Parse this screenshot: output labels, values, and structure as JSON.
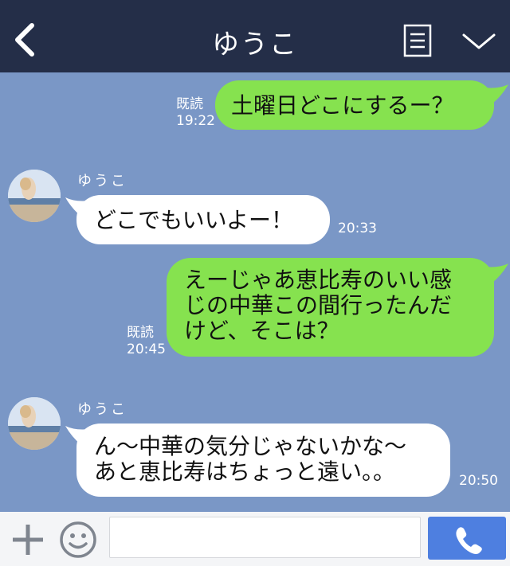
{
  "header": {
    "title": "ゆうこ"
  },
  "messages": [
    {
      "dir": "out",
      "text": "土曜日どこにするー？",
      "read": "既読",
      "time": "19:22"
    },
    {
      "dir": "in",
      "sender": "ゆうこ",
      "text": "どこでもいいよー！",
      "time": "20:33"
    },
    {
      "dir": "out",
      "lines": [
        "えーじゃあ恵比寿のいい感",
        "じの中華この間行ったんだ",
        "けど、そこは？"
      ],
      "read": "既読",
      "time": "20:45"
    },
    {
      "dir": "in",
      "sender": "ゆうこ",
      "lines": [
        "ん〜中華の気分じゃないかな〜",
        "あと恵比寿はちょっと遠い。。"
      ],
      "time": "20:50"
    }
  ],
  "footer": {
    "input_value": ""
  },
  "colors": {
    "header_bg": "#242e48",
    "chat_bg": "#7a97c6",
    "out_bubble": "#86e24f",
    "in_bubble": "#ffffff",
    "call_button": "#4e7fe0"
  },
  "icons": {
    "back": "chevron-left-icon",
    "menu": "menu-icon",
    "collapse": "chevron-down-icon",
    "add": "plus-icon",
    "emoji": "smiley-icon",
    "call": "phone-icon"
  }
}
